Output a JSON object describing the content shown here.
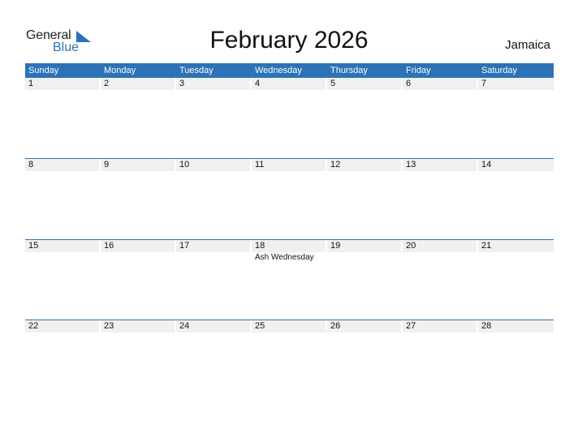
{
  "logo": {
    "general": "General",
    "blue": "Blue",
    "icon": "triangle-flag-icon"
  },
  "title": "February 2026",
  "country": "Jamaica",
  "colors": {
    "accent": "#2c72b6",
    "date_band": "#f0f0f0"
  },
  "weekdays": [
    "Sunday",
    "Monday",
    "Tuesday",
    "Wednesday",
    "Thursday",
    "Friday",
    "Saturday"
  ],
  "weeks": [
    {
      "days": [
        {
          "date": "1",
          "event": ""
        },
        {
          "date": "2",
          "event": ""
        },
        {
          "date": "3",
          "event": ""
        },
        {
          "date": "4",
          "event": ""
        },
        {
          "date": "5",
          "event": ""
        },
        {
          "date": "6",
          "event": ""
        },
        {
          "date": "7",
          "event": ""
        }
      ]
    },
    {
      "days": [
        {
          "date": "8",
          "event": ""
        },
        {
          "date": "9",
          "event": ""
        },
        {
          "date": "10",
          "event": ""
        },
        {
          "date": "11",
          "event": ""
        },
        {
          "date": "12",
          "event": ""
        },
        {
          "date": "13",
          "event": ""
        },
        {
          "date": "14",
          "event": ""
        }
      ]
    },
    {
      "days": [
        {
          "date": "15",
          "event": ""
        },
        {
          "date": "16",
          "event": ""
        },
        {
          "date": "17",
          "event": ""
        },
        {
          "date": "18",
          "event": "Ash Wednesday"
        },
        {
          "date": "19",
          "event": ""
        },
        {
          "date": "20",
          "event": ""
        },
        {
          "date": "21",
          "event": ""
        }
      ]
    },
    {
      "days": [
        {
          "date": "22",
          "event": ""
        },
        {
          "date": "23",
          "event": ""
        },
        {
          "date": "24",
          "event": ""
        },
        {
          "date": "25",
          "event": ""
        },
        {
          "date": "26",
          "event": ""
        },
        {
          "date": "27",
          "event": ""
        },
        {
          "date": "28",
          "event": ""
        }
      ]
    }
  ]
}
